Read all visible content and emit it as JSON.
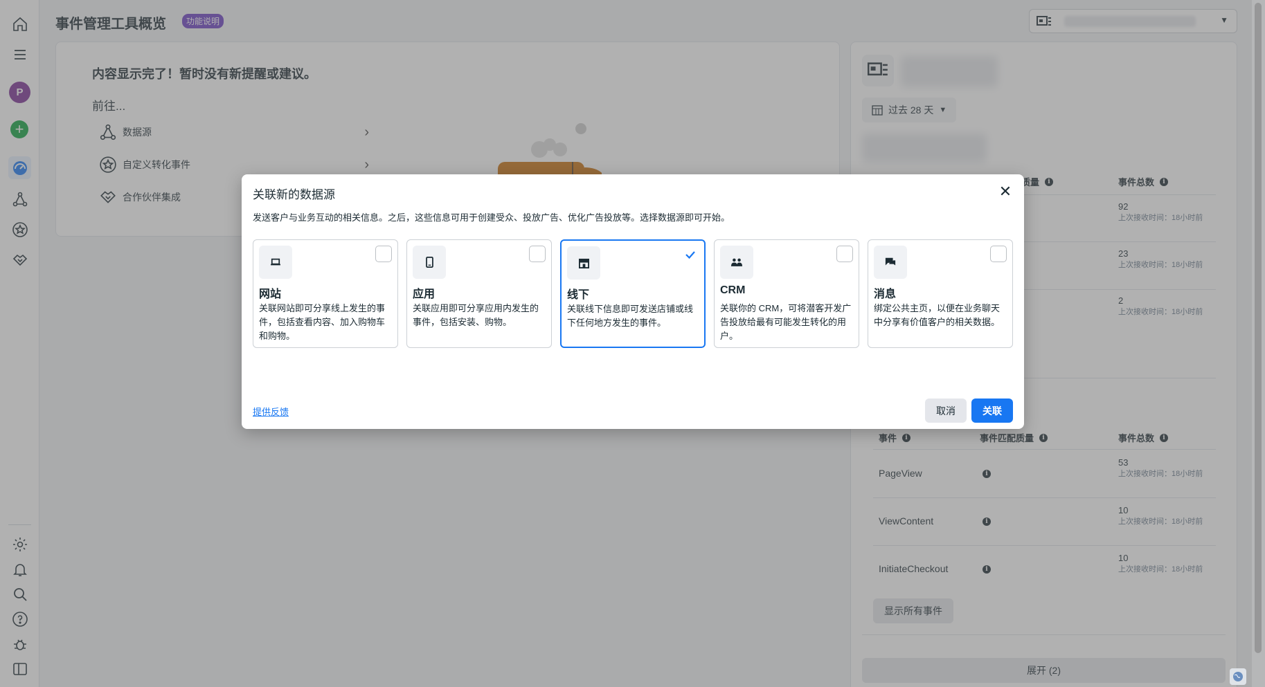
{
  "header": {
    "title": "事件管理工具概览",
    "badge": "功能说明"
  },
  "sidebar": {
    "avatar_letter": "P"
  },
  "left_card": {
    "done_text": "内容显示完了！暂时没有新提醒或建议。",
    "goto_label": "前往...",
    "items": [
      {
        "label": "数据源"
      },
      {
        "label": "自定义转化事件"
      },
      {
        "label": "合作伙伴集成"
      }
    ]
  },
  "right_panel": {
    "date_range": "过去 28 天",
    "table1": {
      "col_quality_partial": "质量",
      "col_total": "事件总数",
      "rows": [
        {
          "total": "92",
          "sub": "上次接收时间：18小时前"
        },
        {
          "total": "23",
          "sub": "上次接收时间：18小时前"
        },
        {
          "total": "2",
          "sub": "上次接收时间：18小时前"
        }
      ]
    },
    "table2": {
      "col_event": "事件",
      "col_quality": "事件匹配质量",
      "col_total": "事件总数",
      "rows": [
        {
          "event": "PageView",
          "total": "53",
          "sub": "上次接收时间：18小时前"
        },
        {
          "event": "ViewContent",
          "total": "10",
          "sub": "上次接收时间：18小时前"
        },
        {
          "event": "InitiateCheckout",
          "total": "10",
          "sub": "上次接收时间：18小时前"
        }
      ]
    },
    "show_all_label": "显示所有事件",
    "expand_label": "展开 (2)"
  },
  "modal": {
    "title": "关联新的数据源",
    "description": "发送客户与业务互动的相关信息。之后，这些信息可用于创建受众、投放广告、优化广告投放等。选择数据源即可开始。",
    "options": [
      {
        "title": "网站",
        "desc": "关联网站即可分享线上发生的事件，包括查看内容、加入购物车和购物。",
        "icon": "laptop-icon",
        "selected": false
      },
      {
        "title": "应用",
        "desc": "关联应用即可分享应用内发生的事件，包括安装、购物。",
        "icon": "phone-icon",
        "selected": false
      },
      {
        "title": "线下",
        "desc": "关联线下信息即可发送店铺或线下任何地方发生的事件。",
        "icon": "store-icon",
        "selected": true
      },
      {
        "title": "CRM",
        "desc": "关联你的 CRM，可将潜客开发广告投放给最有可能发生转化的用户。",
        "icon": "people-icon",
        "selected": false
      },
      {
        "title": "消息",
        "desc": "绑定公共主页，以便在业务聊天中分享有价值客户的相关数据。",
        "icon": "chat-icon",
        "selected": false
      }
    ],
    "feedback_label": "提供反馈",
    "cancel_label": "取消",
    "link_label": "关联",
    "close_glyph": "✕"
  },
  "colors": {
    "primary": "#1877f2",
    "badge": "#6b3ec2",
    "mug": "#c8700f"
  }
}
